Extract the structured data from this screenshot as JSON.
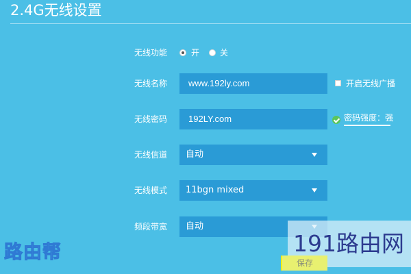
{
  "header": {
    "title": "2.4G无线设置"
  },
  "form": {
    "wireless_function": {
      "label": "无线功能",
      "options": [
        {
          "label": "开",
          "checked": true
        },
        {
          "label": "关",
          "checked": false
        }
      ]
    },
    "ssid": {
      "label": "无线名称",
      "value": "www.192ly.com",
      "broadcast_checkbox": {
        "label": "开启无线广播",
        "checked": false
      }
    },
    "password": {
      "label": "无线密码",
      "value": "192LY.com",
      "strength_text": "密码强度：强",
      "strength_icon": "check-circle-icon"
    },
    "channel": {
      "label": "无线信道",
      "selected": "自动"
    },
    "mode": {
      "label": "无线模式",
      "selected": "11bgn mixed"
    },
    "bandwidth": {
      "label": "频段带宽",
      "selected": "自动"
    }
  },
  "actions": {
    "save_label": "保存"
  },
  "watermarks": {
    "right": "191路由网",
    "left": "路由帮"
  },
  "colors": {
    "background": "#4bbfe6",
    "field": "#2a9bd6",
    "save_button": "#e8f070",
    "strength_ok": "#5bc65b"
  }
}
